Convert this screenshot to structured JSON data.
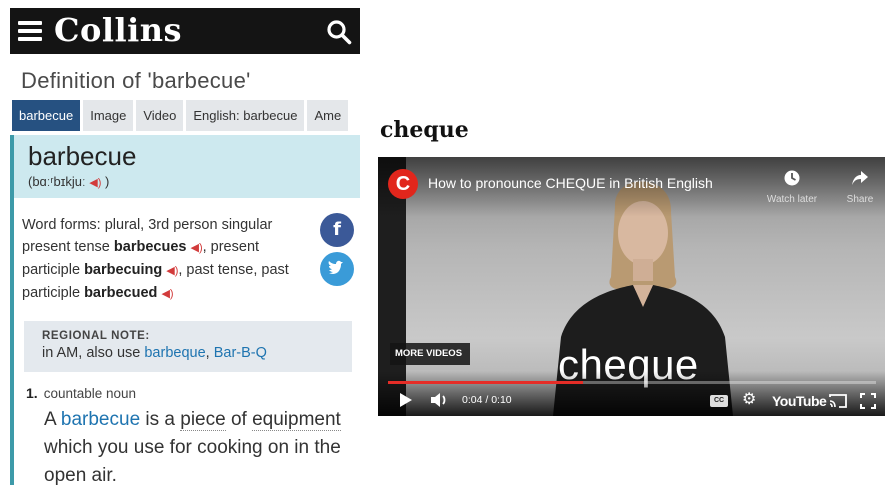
{
  "collins": {
    "logo": "Collins",
    "page_title": "Definition of 'barbecue'",
    "tabs": [
      {
        "label": "barbecue",
        "active": true
      },
      {
        "label": "Image",
        "active": false
      },
      {
        "label": "Video",
        "active": false
      },
      {
        "label": "English: barbecue",
        "active": false
      },
      {
        "label": "Ame",
        "active": false
      }
    ],
    "headword": "barbecue",
    "pronunciation": "(bɑːʳbɪkjuː",
    "pronunciation_end": ")",
    "word_forms": {
      "intro": "Word forms: plural, 3rd person singular present tense ",
      "form1": "barbecues",
      "sep1": ", present participle ",
      "form2": "barbecuing",
      "sep2": ", past tense, past participle ",
      "form3": "barbecued"
    },
    "regional_note": {
      "label": "REGIONAL NOTE:",
      "text": "in AM, also use ",
      "link1": "barbeque",
      "comma": ", ",
      "link2": "Bar-B-Q"
    },
    "sense": {
      "number": "1.",
      "pos": "countable noun",
      "def_a": "A ",
      "def_word": "barbecue",
      "def_b": " is a ",
      "def_piece": "piece",
      "def_c": " of ",
      "def_equipment": "equipment",
      "def_d": " which you use for cooking on in the open ",
      "def_air": "air",
      "def_e": "."
    },
    "share": {
      "facebook_glyph": "f"
    },
    "colors": {
      "header": "#141414",
      "tab_active": "#265181",
      "headword_bg": "#cde9ef",
      "accent_bar": "#3d9aa9",
      "link": "#1e74b0",
      "speaker": "#d23b3b"
    }
  },
  "word": "cheque",
  "video": {
    "channel_glyph": "C",
    "title": "How to pronounce CHEQUE in British English",
    "watch_later": "Watch later",
    "share": "Share",
    "more_videos": "MORE VIDEOS",
    "caption_word": "cheque",
    "time": "0:04 / 0:10",
    "progress": 0.4,
    "cc_label": "CC",
    "brand": "YouTube",
    "colors": {
      "progress": "#e52d27",
      "channel": "#e1261c"
    }
  }
}
